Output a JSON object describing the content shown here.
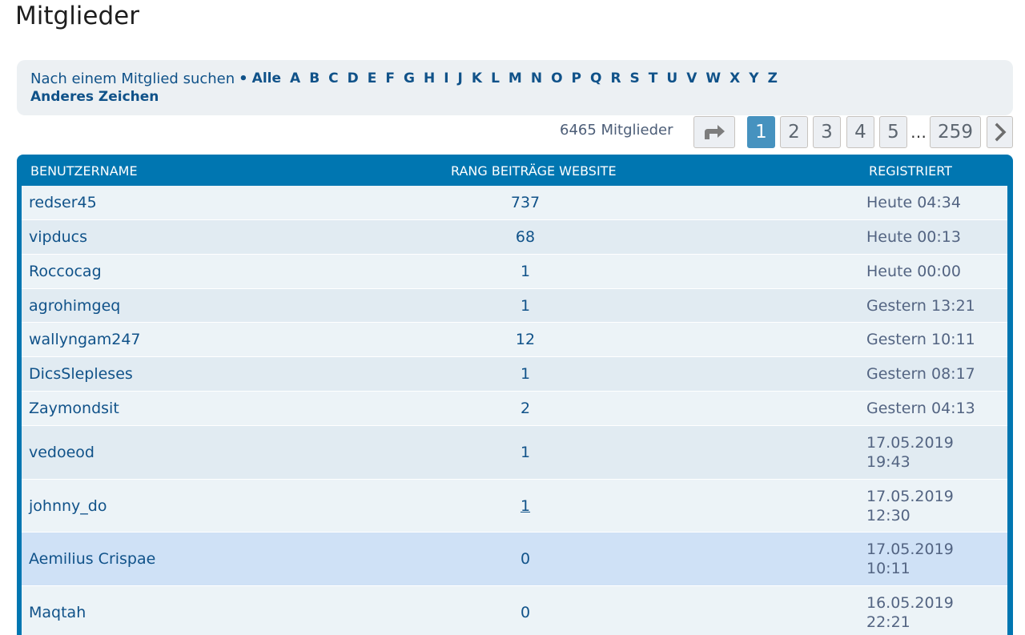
{
  "page": {
    "title": "Mitglieder"
  },
  "search": {
    "label": "Nach einem Mitglied suchen",
    "bullet": "•",
    "all": "Alle",
    "letters": [
      "A",
      "B",
      "C",
      "D",
      "E",
      "F",
      "G",
      "H",
      "I",
      "J",
      "K",
      "L",
      "M",
      "N",
      "O",
      "P",
      "Q",
      "R",
      "S",
      "T",
      "U",
      "V",
      "W",
      "X",
      "Y",
      "Z"
    ],
    "other": "Anderes Zeichen"
  },
  "pagination": {
    "member_count": "6465 Mitglieder",
    "jump_icon": "jump-arrow-icon",
    "pages": [
      "1",
      "2",
      "3",
      "4",
      "5"
    ],
    "ellipsis": "…",
    "last": "259",
    "next_icon": "chevron-right-icon",
    "current": "1"
  },
  "table": {
    "headers": {
      "username": "BENUTZERNAME",
      "middle": "RANG BEITRÄGE WEBSITE",
      "registered": "REGISTRIERT"
    },
    "rows": [
      {
        "name": "redser45",
        "posts": "737",
        "date1": "Heute 04:34",
        "date2": ""
      },
      {
        "name": "vipducs",
        "posts": "68",
        "date1": "Heute 00:13",
        "date2": ""
      },
      {
        "name": "Roccocag",
        "posts": "1",
        "date1": "Heute 00:00",
        "date2": ""
      },
      {
        "name": "agrohimgeq",
        "posts": "1",
        "date1": "Gestern 13:21",
        "date2": ""
      },
      {
        "name": "wallyngam247",
        "posts": "12",
        "date1": "Gestern 10:11",
        "date2": ""
      },
      {
        "name": "DicsSlepleses",
        "posts": "1",
        "date1": "Gestern 08:17",
        "date2": ""
      },
      {
        "name": "Zaymondsit",
        "posts": "2",
        "date1": "Gestern 04:13",
        "date2": ""
      },
      {
        "name": "vedoeod",
        "posts": "1",
        "date1": "17.05.2019",
        "date2": "19:43"
      },
      {
        "name": "johnny_do",
        "posts": "1",
        "date1": "17.05.2019",
        "date2": "12:30"
      },
      {
        "name": "Aemilius Crispae",
        "posts": "0",
        "date1": "17.05.2019",
        "date2": "10:11"
      },
      {
        "name": "Maqtah",
        "posts": "0",
        "date1": "16.05.2019",
        "date2": "22:21"
      }
    ]
  },
  "colors": {
    "header_blue": "#0076b1",
    "link_blue": "#105289",
    "active_page": "#4692bf",
    "row_hover": "#cfe1f6"
  }
}
